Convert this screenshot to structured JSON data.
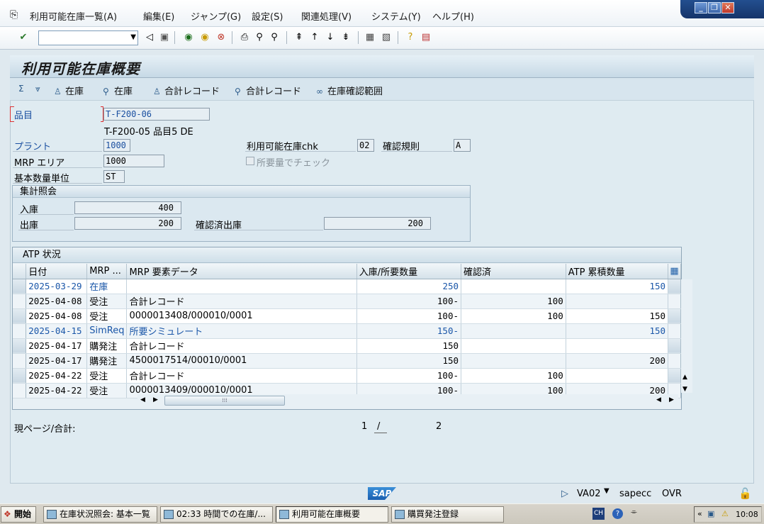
{
  "menubar": {
    "items": [
      "利用可能在庫一覧(A)",
      "編集(E)",
      "ジャンプ(G)",
      "設定(S)",
      "関連処理(V)",
      "システム(Y)",
      "ヘルプ(H)"
    ]
  },
  "toolbar": {
    "command_field_value": ""
  },
  "screen": {
    "title": "利用可能在庫概要"
  },
  "app_toolbar": {
    "buttons": [
      "在庫",
      "在庫",
      "合計レコード",
      "合計レコード",
      "在庫確認範囲"
    ]
  },
  "header": {
    "material_label": "品目",
    "material_value": "T-F200-06",
    "material_desc": "T-F200-05  品目5 DE",
    "plant_label": "プラント",
    "plant_value": "1000",
    "mrp_area_label": "MRP エリア",
    "mrp_area_value": "1000",
    "base_uom_label": "基本数量単位",
    "base_uom_value": "ST",
    "atp_check_label": "利用可能在庫chk",
    "atp_check_value": "02",
    "check_rule_label": "確認規則",
    "check_rule_value": "A",
    "check_req_label": "所要量でチェック"
  },
  "summary": {
    "title": "集計照会",
    "receipts_label": "入庫",
    "receipts_value": "400",
    "issues_label": "出庫",
    "issues_value": "200",
    "confirmed_issues_label": "確認済出庫",
    "confirmed_issues_value": "200"
  },
  "atp_table": {
    "title": "ATP 状況",
    "columns": [
      "日付",
      "MRP ...",
      "MRP 要素データ",
      "入庫/所要数量",
      "確認済",
      "ATP 累積数量"
    ],
    "rows": [
      {
        "date": "2025-03-29",
        "type": "在庫",
        "data": "",
        "qty": "250",
        "confirmed": "",
        "cum": "150",
        "highlight": true
      },
      {
        "date": "2025-04-08",
        "type": "受注",
        "data": "合計レコード",
        "qty": "100-",
        "confirmed": "100",
        "cum": "",
        "highlight": false
      },
      {
        "date": "2025-04-08",
        "type": "受注",
        "data": "0000013408/000010/0001",
        "qty": "100-",
        "confirmed": "100",
        "cum": "150",
        "highlight": false
      },
      {
        "date": "2025-04-15",
        "type": "SimReq",
        "data": "所要シミュレート",
        "qty": "150-",
        "confirmed": "",
        "cum": "150",
        "highlight": true
      },
      {
        "date": "2025-04-17",
        "type": "購発注",
        "data": "合計レコード",
        "qty": "150",
        "confirmed": "",
        "cum": "",
        "highlight": false
      },
      {
        "date": "2025-04-17",
        "type": "購発注",
        "data": "4500017514/00010/0001",
        "qty": "150",
        "confirmed": "",
        "cum": "200",
        "highlight": false
      },
      {
        "date": "2025-04-22",
        "type": "受注",
        "data": "合計レコード",
        "qty": "100-",
        "confirmed": "100",
        "cum": "",
        "highlight": false
      },
      {
        "date": "2025-04-22",
        "type": "受注",
        "data": "0000013409/000010/0001",
        "qty": "100-",
        "confirmed": "100",
        "cum": "200",
        "highlight": false
      }
    ]
  },
  "paging": {
    "label": "現ページ/合計:",
    "current": "1",
    "slash": "/",
    "total": "2"
  },
  "status": {
    "transaction": "VA02",
    "server": "sapecc",
    "mode": "OVR"
  },
  "taskbar": {
    "start": "開始",
    "tasks": [
      "在庫状況照会: 基本一覧",
      "02:33 時間での在庫/...",
      "利用可能在庫概要",
      "購買発注登録"
    ],
    "lang": "CH",
    "time": "10:08"
  }
}
